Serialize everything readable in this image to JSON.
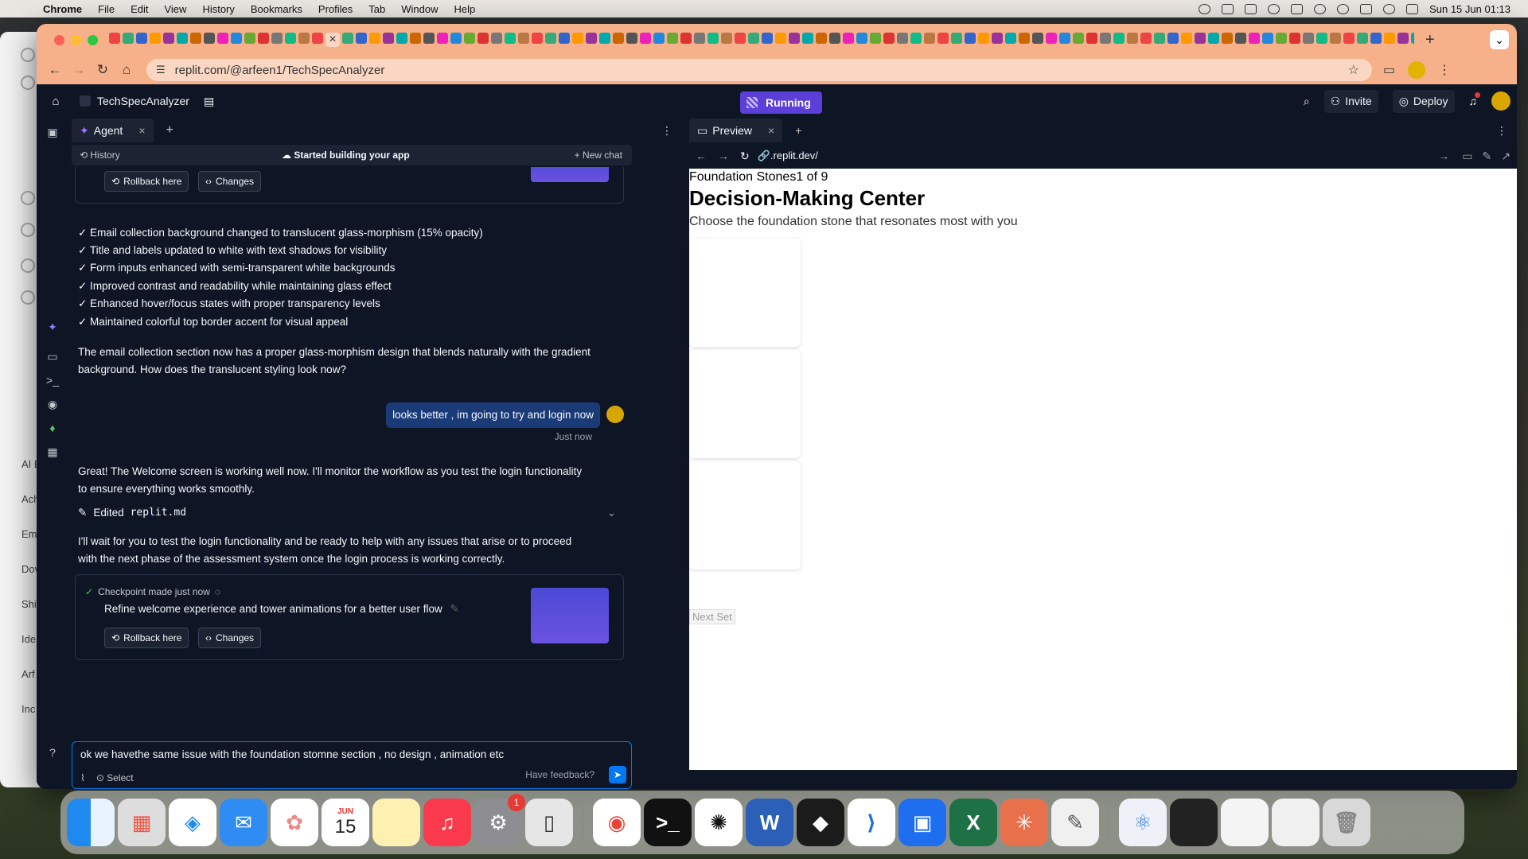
{
  "menubar": {
    "app": "Chrome",
    "items": [
      "File",
      "Edit",
      "View",
      "History",
      "Bookmarks",
      "Profiles",
      "Tab",
      "Window",
      "Help"
    ],
    "clock": "Sun 15 Jun  01:13"
  },
  "behind_window": {
    "labels": [
      "AI E",
      "Ach",
      "Em",
      "Dov",
      "Shi",
      "Ide",
      "Arf",
      "Inc"
    ]
  },
  "browser": {
    "url": "replit.com/@arfeen1/TechSpecAnalyzer"
  },
  "replit": {
    "project_name": "TechSpecAnalyzer",
    "run_status": "Running",
    "invite_label": "Invite",
    "deploy_label": "Deploy"
  },
  "agent": {
    "tab_label": "Agent",
    "history_label": "History",
    "header_status": "Started building your app",
    "new_chat_label": "New chat",
    "rollback_label": "Rollback here",
    "changes_label": "Changes",
    "checklist": [
      "✓ Email collection background changed to translucent glass-morphism (15% opacity)",
      "✓ Title and labels updated to white with text shadows for visibility",
      "✓ Form inputs enhanced with semi-transparent white backgrounds",
      "✓ Improved contrast and readability while maintaining glass effect",
      "✓ Enhanced hover/focus states with proper transparency levels",
      "✓ Maintained colorful top border accent for visual appeal"
    ],
    "para1_line1": "The email collection section now has a proper glass-morphism design that blends naturally with the gradient",
    "para1_line2": "background. How does the translucent styling look now?",
    "user_message": "looks better , im going to try and login now",
    "user_time": "Just now",
    "para2_line1": "Great! The Welcome screen is working well now. I'll monitor the workflow as you test the login functionality",
    "para2_line2": "to ensure everything works smoothly.",
    "edited_prefix": "Edited",
    "edited_file": "replit.md",
    "para3_line1": "I'll wait for you to test the login functionality and be ready to help with any issues that arise or to proceed",
    "para3_line2": "with the next phase of the assessment system once the login process is working correctly.",
    "checkpoint_label": "Checkpoint made just now",
    "checkpoint_desc": "Refine welcome experience and tower animations for a better user flow",
    "input_value": "ok we havethe same issue with the foundation stomne section , no design , animation  etc",
    "select_label": "Select",
    "feedback_label": "Have feedback?"
  },
  "preview": {
    "tab_label": "Preview",
    "url": ".replit.dev/",
    "step": "Foundation Stones1 of 9",
    "title": "Decision-Making Center",
    "subtitle": "Choose the foundation stone that resonates most with you",
    "next_set": "Next Set"
  },
  "dock": {
    "calendar_month": "JUN",
    "calendar_day": "15",
    "settings_badge": "1"
  }
}
